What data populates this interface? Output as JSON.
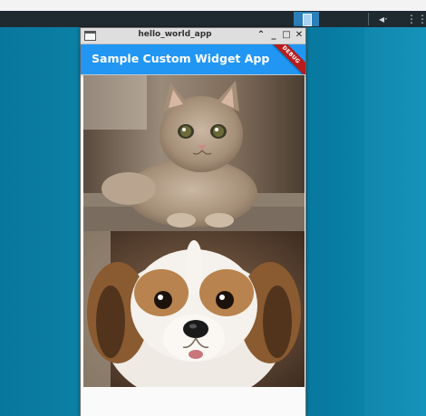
{
  "window": {
    "title": "hello_world_app"
  },
  "app": {
    "appbar_title": "Sample Custom Widget App",
    "debug_label": "DEBUG",
    "accent_color": "#2196f3",
    "debug_color": "#b71c1c"
  },
  "images": [
    {
      "subject": "kitten photo"
    },
    {
      "subject": "puppy photo"
    }
  ],
  "taskbar": {
    "icons": [
      "volume-icon",
      "network-icon"
    ]
  }
}
